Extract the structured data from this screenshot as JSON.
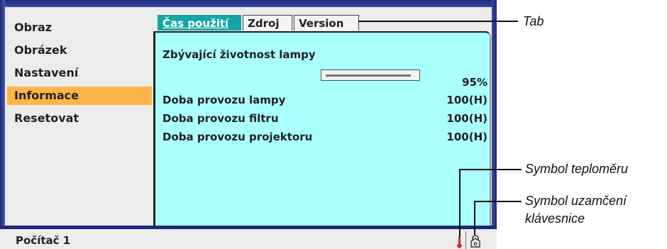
{
  "menu": {
    "items": [
      {
        "label": "Obraz",
        "active": false
      },
      {
        "label": "Obrázek",
        "active": false
      },
      {
        "label": "Nastavení",
        "active": false
      },
      {
        "label": "Informace",
        "active": true
      },
      {
        "label": "Resetovat",
        "active": false
      }
    ]
  },
  "tabs": [
    {
      "label": "Čas použití",
      "active": true
    },
    {
      "label": "Zdroj",
      "active": false
    },
    {
      "label": "Version",
      "active": false
    }
  ],
  "panel": {
    "lamp_remaining_label": "Zbývající životnost lampy",
    "lamp_remaining_value": "95%",
    "lamp_remaining_fraction": 0.95,
    "rows": [
      {
        "label": "Doba provozu lampy",
        "value": "100(H)"
      },
      {
        "label": "Doba provozu filtru",
        "value": "100(H)"
      },
      {
        "label": "Doba provozu projektoru",
        "value": "100(H)"
      }
    ]
  },
  "status": {
    "source": "Počítač 1",
    "thermometer_icon": "thermometer-icon",
    "keylock_icon": "keyboard-lock-icon"
  },
  "callouts": {
    "tab": "Tab",
    "thermometer": "Symbol teploměru",
    "keylock_line1": "Symbol uzamčení",
    "keylock_line2": "klávesnice"
  },
  "colors": {
    "panel_bg": "#aaffff",
    "active_menu": "#ffb448",
    "active_tab": "#14a6a6",
    "frame": "#1c2a7a"
  }
}
